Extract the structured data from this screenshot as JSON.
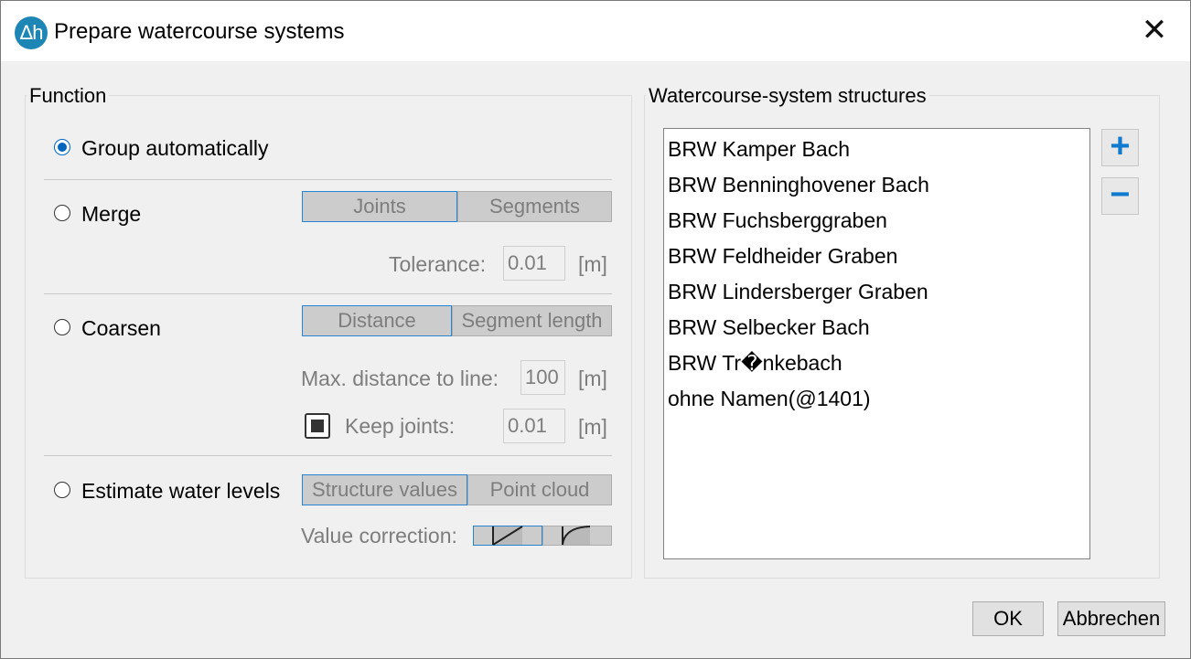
{
  "window": {
    "title": "Prepare watercourse systems",
    "app_icon": "Δh",
    "close_icon": "close-icon"
  },
  "function_group": {
    "title": "Function",
    "group_auto": {
      "label": "Group automatically",
      "checked": true
    },
    "merge": {
      "label": "Merge",
      "checked": false,
      "modes": [
        "Joints",
        "Segments"
      ],
      "selected_mode": "Joints",
      "tolerance_label": "Tolerance:",
      "tolerance_value": "0.01",
      "tolerance_unit": "[m]"
    },
    "coarsen": {
      "label": "Coarsen",
      "checked": false,
      "modes": [
        "Distance",
        "Segment length"
      ],
      "selected_mode": "Distance",
      "max_distance_label": "Max. distance to line:",
      "max_distance_value": "100",
      "max_distance_unit": "[m]",
      "keep_joints_label": "Keep joints:",
      "keep_joints_checked": true,
      "keep_joints_value": "0.01",
      "keep_joints_unit": "[m]"
    },
    "estimate": {
      "label": "Estimate water levels",
      "checked": false,
      "modes": [
        "Structure values",
        "Point cloud"
      ],
      "selected_mode": "Structure values",
      "value_correction_label": "Value correction:",
      "correction_icons": [
        "linear-correction-icon",
        "curve-correction-icon"
      ]
    }
  },
  "structures_group": {
    "title": "Watercourse-system structures",
    "items": [
      "BRW Kamper Bach",
      "BRW Benninghovener Bach",
      "BRW Fuchsberggraben",
      "BRW Feldheider Graben",
      "BRW Lindersberger Graben",
      "BRW Selbecker Bach",
      "BRW Tr�nkebach",
      "ohne Namen(@1401)"
    ],
    "add_label": "+",
    "remove_label": "−"
  },
  "buttons": {
    "ok": "OK",
    "cancel": "Abbrechen"
  },
  "colors": {
    "accent": "#0067c0",
    "icon_blue": "#1d86b5",
    "disabled_text": "#7d7d7d"
  }
}
